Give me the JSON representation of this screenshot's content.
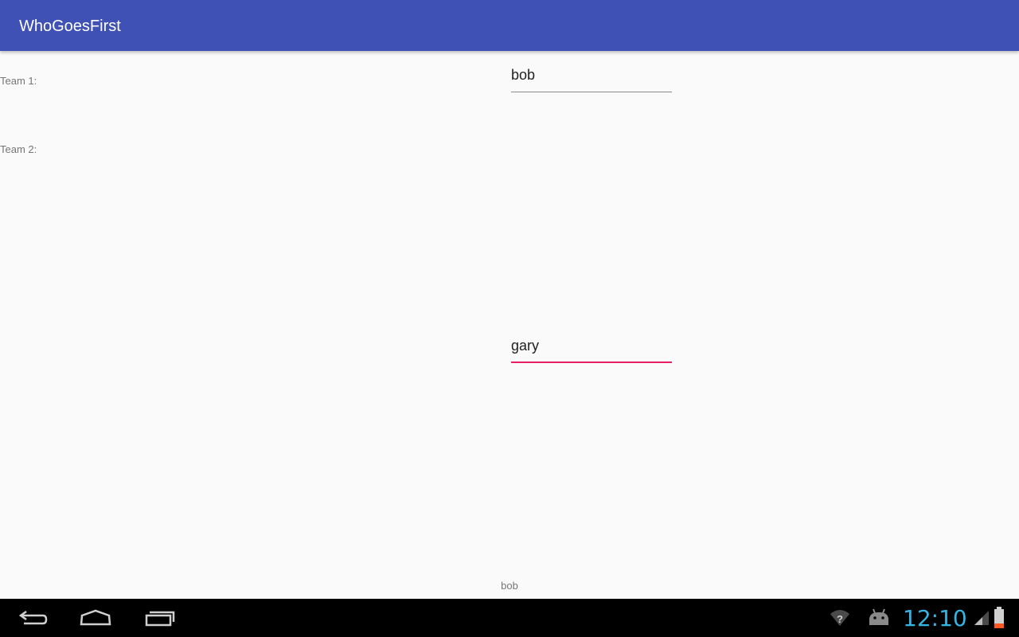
{
  "app_bar": {
    "title": "WhoGoesFirst",
    "color": "#3f51b5"
  },
  "form": {
    "team1_label": "Team 1:",
    "team2_label": "Team 2:",
    "team1_value": "bob",
    "team2_value": "gary",
    "focused_field": "team2",
    "accent_color": "#e91e63"
  },
  "result": {
    "text": "bob"
  },
  "system_bar": {
    "time": "12:10",
    "nav_buttons": [
      "back-icon",
      "home-icon",
      "recents-icon"
    ],
    "status_icons": [
      "wifi-unknown-icon",
      "android-debug-icon",
      "cell-signal-icon",
      "battery-icon"
    ]
  }
}
